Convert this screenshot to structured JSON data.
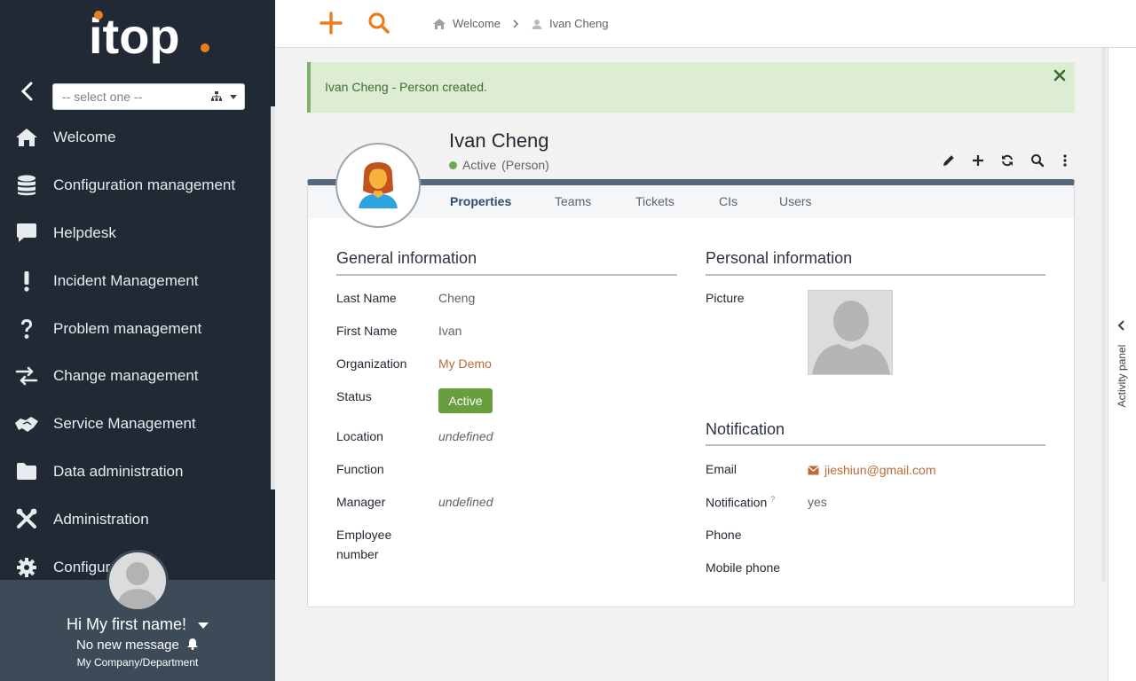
{
  "app": {
    "brand": "itop"
  },
  "sidebar": {
    "org_select": {
      "placeholder": "-- select one --"
    },
    "items": [
      {
        "label": "Welcome",
        "icon": "home-icon"
      },
      {
        "label": "Configuration management",
        "icon": "database-icon"
      },
      {
        "label": "Helpdesk",
        "icon": "speech-bubble-icon"
      },
      {
        "label": "Incident Management",
        "icon": "exclamation-icon"
      },
      {
        "label": "Problem management",
        "icon": "question-icon"
      },
      {
        "label": "Change management",
        "icon": "exchange-arrows-icon"
      },
      {
        "label": "Service Management",
        "icon": "handshake-icon"
      },
      {
        "label": "Data administration",
        "icon": "folder-icon"
      },
      {
        "label": "Administration",
        "icon": "tools-icon"
      },
      {
        "label": "Configur",
        "icon": "gear-icon"
      }
    ],
    "user": {
      "greeting": "Hi My first name!",
      "messages": "No new message",
      "org": "My Company/Department"
    }
  },
  "topbar": {
    "breadcrumb": [
      {
        "label": "Welcome",
        "icon": "home-icon"
      },
      {
        "label": "Ivan Cheng",
        "icon": "person-icon"
      }
    ]
  },
  "alert": {
    "text": "Ivan Cheng - Person created."
  },
  "object": {
    "name": "Ivan Cheng",
    "status": "Active",
    "class": "(Person)",
    "tabs": [
      "Properties",
      "Teams",
      "Tickets",
      "CIs",
      "Users"
    ],
    "active_tab": "Properties"
  },
  "general": {
    "title": "General information",
    "fields": {
      "last_name": {
        "label": "Last Name",
        "value": "Cheng"
      },
      "first_name": {
        "label": "First Name",
        "value": "Ivan"
      },
      "organization": {
        "label": "Organization",
        "value": "My Demo"
      },
      "status": {
        "label": "Status",
        "value": "Active"
      },
      "location": {
        "label": "Location",
        "value": "undefined"
      },
      "function": {
        "label": "Function",
        "value": ""
      },
      "manager": {
        "label": "Manager",
        "value": "undefined"
      },
      "employee_number": {
        "label1": "Employee",
        "label2": "number",
        "value": ""
      }
    }
  },
  "personal": {
    "title": "Personal information",
    "picture_label": "Picture"
  },
  "notification": {
    "title": "Notification",
    "email": {
      "label": "Email",
      "value": "jieshiun@gmail.com"
    },
    "notify": {
      "label": "Notification",
      "hint": "?",
      "value": "yes"
    },
    "phone": {
      "label": "Phone",
      "value": ""
    },
    "mobile": {
      "label": "Mobile phone",
      "value": ""
    }
  },
  "activity_panel": {
    "label": "Activity panel"
  },
  "colors": {
    "accent": "#ea7d1e",
    "sidebar": "#212934",
    "success": "#689f3e",
    "link": "#b96c38"
  }
}
